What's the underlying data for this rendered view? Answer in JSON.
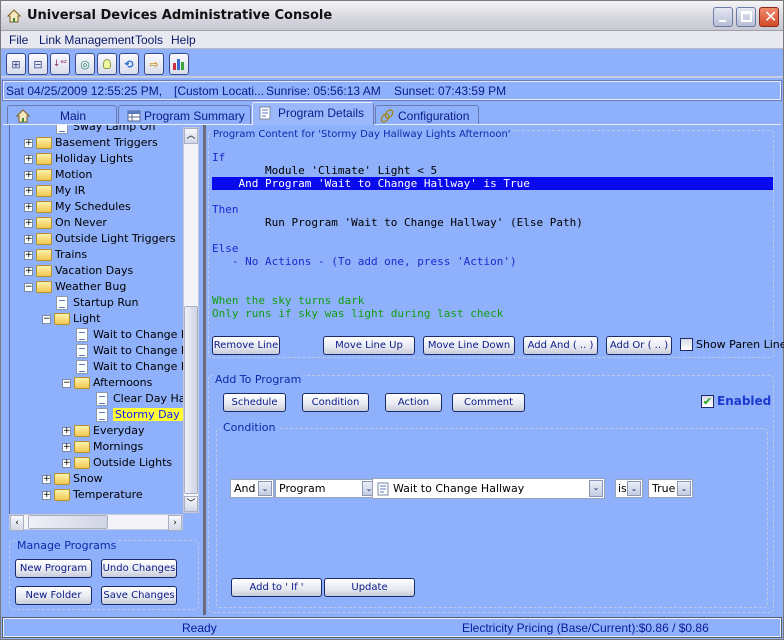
{
  "window": {
    "title": "Universal Devices Administrative Console",
    "controls": {
      "minimize": "minimize",
      "maximize": "maximize",
      "close": "close"
    }
  },
  "menu": [
    "File",
    "Link Management",
    "Tools",
    "Help"
  ],
  "toolbar": {
    "buttons": [
      {
        "icon": "expand-all-icon",
        "glyph": "⊞"
      },
      {
        "icon": "collapse-all-icon",
        "glyph": "⊟"
      },
      {
        "icon": "sort-az-icon",
        "glyph": "↓ᵃᶻ"
      },
      {
        "icon": "network-icon",
        "glyph": "◎"
      },
      {
        "icon": "light-bulb-icon",
        "glyph": "💡"
      },
      {
        "icon": "refresh-icon",
        "glyph": "⟲"
      },
      {
        "icon": "import-icon",
        "glyph": "⇨"
      },
      {
        "icon": "chart-icon",
        "glyph": "▥"
      }
    ]
  },
  "datebar": {
    "datetime": "Sat 04/25/2009 12:55:25 PM,",
    "location": "[Custom Locati...",
    "sunrise": "Sunrise: 05:56:13 AM",
    "sunset": "Sunset: 07:43:59 PM"
  },
  "tabs": [
    {
      "label": "Main",
      "icon": "home-icon",
      "active": false
    },
    {
      "label": "Program Summary",
      "icon": "table-icon",
      "active": false
    },
    {
      "label": "Program Details",
      "icon": "document-icon",
      "active": true
    },
    {
      "label": "Configuration",
      "icon": "link-icon",
      "active": false
    }
  ],
  "tree": {
    "items": [
      {
        "label": "Sway Lamp On",
        "type": "program",
        "level": 1
      },
      {
        "label": "Basement Triggers",
        "type": "folder",
        "level": 0,
        "expander": "+"
      },
      {
        "label": "Holiday Lights",
        "type": "folder",
        "level": 0,
        "expander": "+"
      },
      {
        "label": "Motion",
        "type": "folder",
        "level": 0,
        "expander": "+"
      },
      {
        "label": "My IR",
        "type": "folder",
        "level": 0,
        "expander": "+"
      },
      {
        "label": "My Schedules",
        "type": "folder",
        "level": 0,
        "expander": "+"
      },
      {
        "label": "On Never",
        "type": "folder",
        "level": 0,
        "expander": "+"
      },
      {
        "label": "Outside Light Triggers",
        "type": "folder",
        "level": 0,
        "expander": "+"
      },
      {
        "label": "Trains",
        "type": "folder",
        "level": 0,
        "expander": "+"
      },
      {
        "label": "Vacation Days",
        "type": "folder",
        "level": 0,
        "expander": "+"
      },
      {
        "label": "Weather Bug",
        "type": "folder",
        "level": 0,
        "expander": "−"
      },
      {
        "label": "Startup Run",
        "type": "program",
        "level": 1
      },
      {
        "label": "Light",
        "type": "folder",
        "level": 1,
        "expander": "−"
      },
      {
        "label": "Wait to Change Fa",
        "type": "program",
        "level": 2
      },
      {
        "label": "Wait to Change Ha",
        "type": "program",
        "level": 2
      },
      {
        "label": "Wait to Change Liv",
        "type": "program",
        "level": 2
      },
      {
        "label": "Afternoons",
        "type": "folder",
        "level": 2,
        "expander": "−"
      },
      {
        "label": "Clear Day Hallw",
        "type": "program",
        "level": 3
      },
      {
        "label": "Stormy Day Ha",
        "type": "program",
        "level": 3,
        "selected": true
      },
      {
        "label": "Everyday",
        "type": "folder",
        "level": 2,
        "expander": "+"
      },
      {
        "label": "Mornings",
        "type": "folder",
        "level": 2,
        "expander": "+"
      },
      {
        "label": "Outside Lights",
        "type": "folder",
        "level": 2,
        "expander": "+"
      },
      {
        "label": "Snow",
        "type": "folder",
        "level": 1,
        "expander": "+"
      },
      {
        "label": "Temperature",
        "type": "folder",
        "level": 1,
        "expander": "+"
      }
    ]
  },
  "manage": {
    "title": "Manage Programs",
    "new_program": "New Program",
    "undo_changes": "Undo Changes",
    "new_folder": "New Folder",
    "save_changes": "Save Changes"
  },
  "program": {
    "title": "Program Content for 'Stormy Day Hallway Lights Afternoon'",
    "lines": [
      {
        "text": "If",
        "style": "kw"
      },
      {
        "text": "        Module 'Climate' Light < 5",
        "style": "normal"
      },
      {
        "text": "    And Program 'Wait to Change Hallway' is True",
        "style": "hl"
      },
      {
        "text": "",
        "style": "normal"
      },
      {
        "text": "Then",
        "style": "kw"
      },
      {
        "text": "        Run Program 'Wait to Change Hallway' (Else Path)",
        "style": "normal"
      },
      {
        "text": "",
        "style": "normal"
      },
      {
        "text": "Else",
        "style": "kw"
      },
      {
        "text": "   - No Actions - (To add one, press 'Action')",
        "style": "kw"
      },
      {
        "text": "",
        "style": "normal"
      },
      {
        "text": "",
        "style": "normal"
      },
      {
        "text": "When the sky turns dark",
        "style": "cm"
      },
      {
        "text": "Only runs if sky was light during last check",
        "style": "cm"
      }
    ],
    "buttons": {
      "remove_line": "Remove Line",
      "move_up": "Move Line Up",
      "move_down": "Move Line Down",
      "add_and": "Add And ( .. )",
      "add_or": "Add Or ( .. )"
    },
    "show_paren_lines": {
      "label": "Show Paren Lines",
      "checked": false
    }
  },
  "add_to_program": {
    "title": "Add To Program",
    "schedule": "Schedule",
    "condition": "Condition",
    "action": "Action",
    "comment": "Comment",
    "enabled": {
      "label": "Enabled",
      "checked": true,
      "check_glyph": "✔"
    }
  },
  "condition": {
    "title": "Condition",
    "conjunction": "And",
    "type": "Program",
    "program": "Wait to Change Hallway",
    "operator": "is",
    "value": "True",
    "arrow_glyph": "⌄",
    "add_to_if": "Add to ' If '",
    "update": "Update"
  },
  "status": {
    "text": "Ready",
    "pricing": "Electricity Pricing (Base/Current):$0.86 / $0.86"
  }
}
